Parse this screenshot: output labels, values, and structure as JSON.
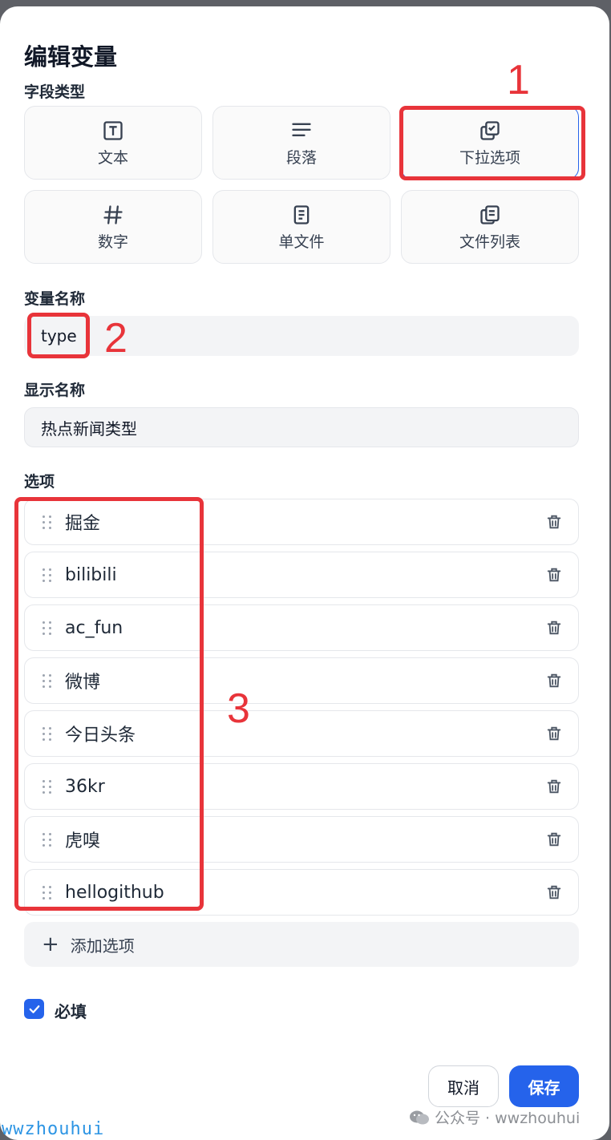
{
  "dialog": {
    "title": "编辑变量",
    "field_type_label": "字段类型",
    "types": [
      {
        "label": "文本",
        "icon": "text-type-icon"
      },
      {
        "label": "段落",
        "icon": "paragraph-icon"
      },
      {
        "label": "下拉选项",
        "icon": "dropdown-checkbox-icon",
        "selected": true
      },
      {
        "label": "数字",
        "icon": "hash-icon"
      },
      {
        "label": "单文件",
        "icon": "file-icon"
      },
      {
        "label": "文件列表",
        "icon": "file-list-icon"
      }
    ],
    "var_name_label": "变量名称",
    "var_name_value": "type",
    "display_name_label": "显示名称",
    "display_name_value": "热点新闻类型",
    "options_label": "选项",
    "options": [
      "掘金",
      "bilibili",
      "ac_fun",
      "微博",
      "今日头条",
      "36kr",
      "虎嗅",
      "hellogithub"
    ],
    "add_option_label": "添加选项",
    "required_label": "必填",
    "required_checked": true,
    "cancel_label": "取消",
    "save_label": "保存"
  },
  "annotations": [
    "1",
    "2",
    "3"
  ],
  "watermark": {
    "left": "wwzhouhui",
    "right": "公众号 · wwzhouhui"
  },
  "colors": {
    "accent": "#2563eb",
    "annotation": "#e8343a"
  }
}
